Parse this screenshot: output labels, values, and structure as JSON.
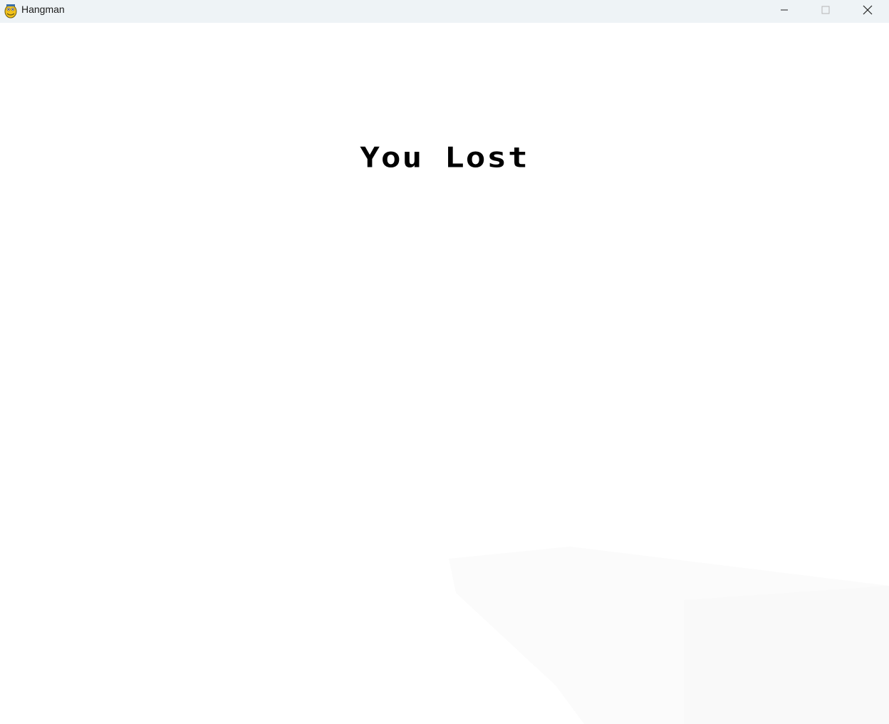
{
  "window": {
    "title": "Hangman",
    "app_icon": "pygame-snake-icon",
    "controls": {
      "minimize_icon": "minimize-icon",
      "maximize_icon": "maximize-icon",
      "close_icon": "close-icon"
    }
  },
  "game": {
    "result_message": "You Lost",
    "background_color": "#ffffff",
    "text_color": "#000000"
  }
}
